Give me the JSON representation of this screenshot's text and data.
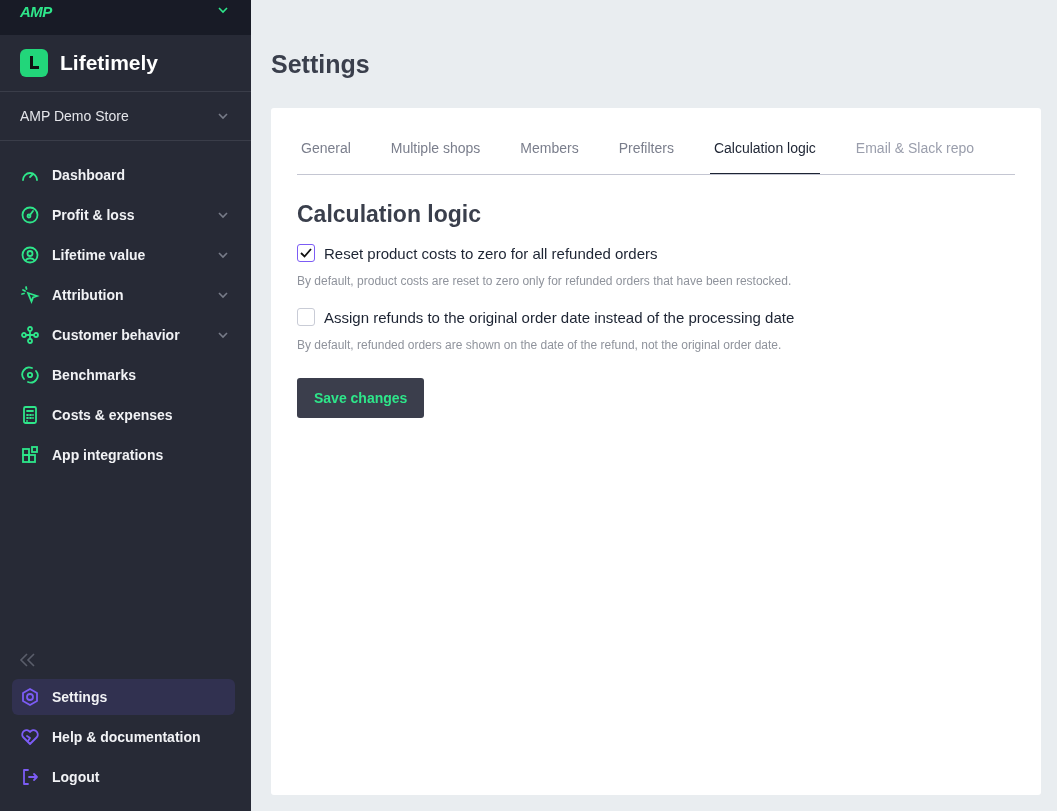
{
  "sidebar": {
    "org": {
      "logo": "AMP"
    },
    "brand": "Lifetimely",
    "store": "AMP Demo Store",
    "items": [
      {
        "label": "Dashboard",
        "expandable": false
      },
      {
        "label": "Profit & loss",
        "expandable": true
      },
      {
        "label": "Lifetime value",
        "expandable": true
      },
      {
        "label": "Attribution",
        "expandable": true
      },
      {
        "label": "Customer behavior",
        "expandable": true
      },
      {
        "label": "Benchmarks",
        "expandable": false
      },
      {
        "label": "Costs & expenses",
        "expandable": false
      },
      {
        "label": "App integrations",
        "expandable": false
      }
    ],
    "footer_items": [
      {
        "label": "Settings",
        "selected": true
      },
      {
        "label": "Help & documentation",
        "selected": false
      },
      {
        "label": "Logout",
        "selected": false
      }
    ]
  },
  "page": {
    "title": "Settings",
    "tabs": [
      {
        "label": "General",
        "selected": false
      },
      {
        "label": "Multiple shops",
        "selected": false
      },
      {
        "label": "Members",
        "selected": false
      },
      {
        "label": "Prefilters",
        "selected": false
      },
      {
        "label": "Calculation logic",
        "selected": true
      },
      {
        "label": "Email & Slack repo",
        "selected": false
      }
    ],
    "section_title": "Calculation logic",
    "options": [
      {
        "label": "Reset product costs to zero for all refunded orders",
        "checked": true,
        "hint": "By default, product costs are reset to zero only for refunded orders that have been restocked."
      },
      {
        "label": "Assign refunds to the original order date instead of the processing date",
        "checked": false,
        "hint": "By default, refunded orders are shown on the date of the refund, not the original order date."
      }
    ],
    "save_button": "Save changes"
  }
}
